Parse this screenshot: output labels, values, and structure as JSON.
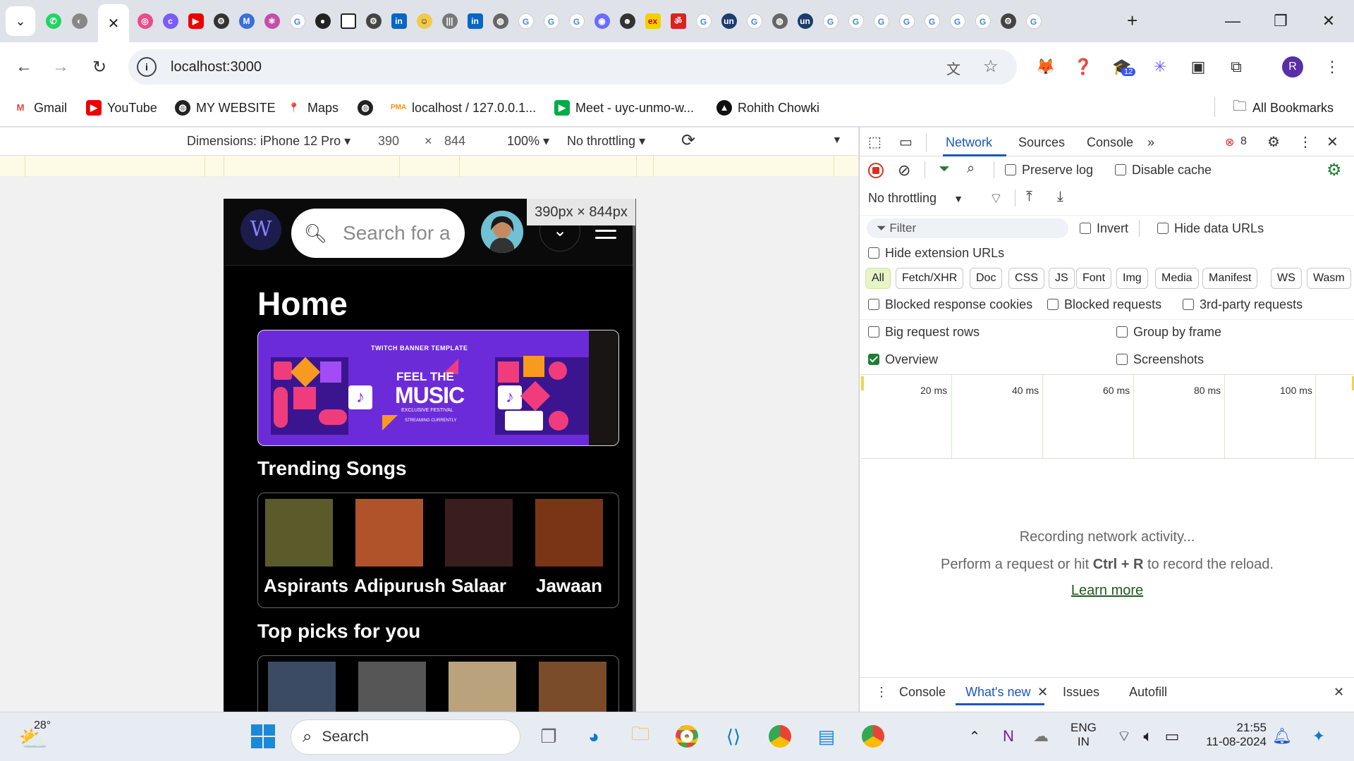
{
  "browser": {
    "url": "localhost:3000",
    "bookmarks": [
      "Gmail",
      "YouTube",
      "MY WEBSITE",
      "Maps",
      "localhost / 127.0.0.1...",
      "Meet - uyc-unmo-w...",
      "Rohith Chowki"
    ],
    "all_bookmarks": "All Bookmarks",
    "profile_initial": "R",
    "ext_badge": "12"
  },
  "device_toolbar": {
    "dimensions_label": "Dimensions: iPhone 12 Pro",
    "width": "390",
    "times": "×",
    "height": "844",
    "zoom": "100%",
    "throttling": "No throttling",
    "size_tip": "390px × 844px"
  },
  "app": {
    "search_placeholder": "Search for a",
    "page_title": "Home",
    "banner": {
      "small": "TWITCH BANNER TEMPLATE",
      "line1": "FEEL THE",
      "line2": "MUSIC",
      "line3": "EXCLUSIVE FESTIVAL",
      "line4": "STREAMING CURRENTLY"
    },
    "trending_title": "Trending Songs",
    "trending": [
      {
        "label": "Aspirants",
        "color": "#5b5a2a"
      },
      {
        "label": "Adipurush",
        "color": "#b0532a"
      },
      {
        "label": "Salaar",
        "color": "#3a1e1e"
      },
      {
        "label": "Jawaan",
        "color": "#7a3416"
      }
    ],
    "picks_title": "Top picks for you",
    "picks_colors": [
      "#3a4b63",
      "#565656",
      "#b9a27c",
      "#7a4c2a"
    ]
  },
  "devtools": {
    "tabs": [
      "Network",
      "Sources",
      "Console"
    ],
    "error_count": "8",
    "preserve_log": "Preserve log",
    "disable_cache": "Disable cache",
    "throttling": "No throttling",
    "filter_placeholder": "Filter",
    "invert": "Invert",
    "hide_data_urls": "Hide data URLs",
    "hide_extension_urls": "Hide extension URLs",
    "type_filters": [
      "All",
      "Fetch/XHR",
      "Doc",
      "CSS",
      "JS",
      "Font",
      "Img",
      "Media",
      "Manifest",
      "WS",
      "Wasm"
    ],
    "blocked_response_cookies": "Blocked response cookies",
    "blocked_requests": "Blocked requests",
    "third_party": "3rd-party requests",
    "big_request_rows": "Big request rows",
    "group_by_frame": "Group by frame",
    "overview": "Overview",
    "screenshots": "Screenshots",
    "timeline_labels": [
      "20 ms",
      "40 ms",
      "60 ms",
      "80 ms",
      "100 ms"
    ],
    "empty_title": "Recording network activity...",
    "empty_hint_pre": "Perform a request or hit ",
    "empty_hint_keys": "Ctrl + R",
    "empty_hint_post": " to record the reload.",
    "learn_more": "Learn more",
    "drawer_tabs": [
      "Console",
      "What's new",
      "Issues",
      "Autofill"
    ]
  },
  "taskbar": {
    "weather": "28°",
    "search": "Search",
    "lang1": "ENG",
    "lang2": "IN",
    "time": "21:55",
    "date": "11-08-2024"
  }
}
